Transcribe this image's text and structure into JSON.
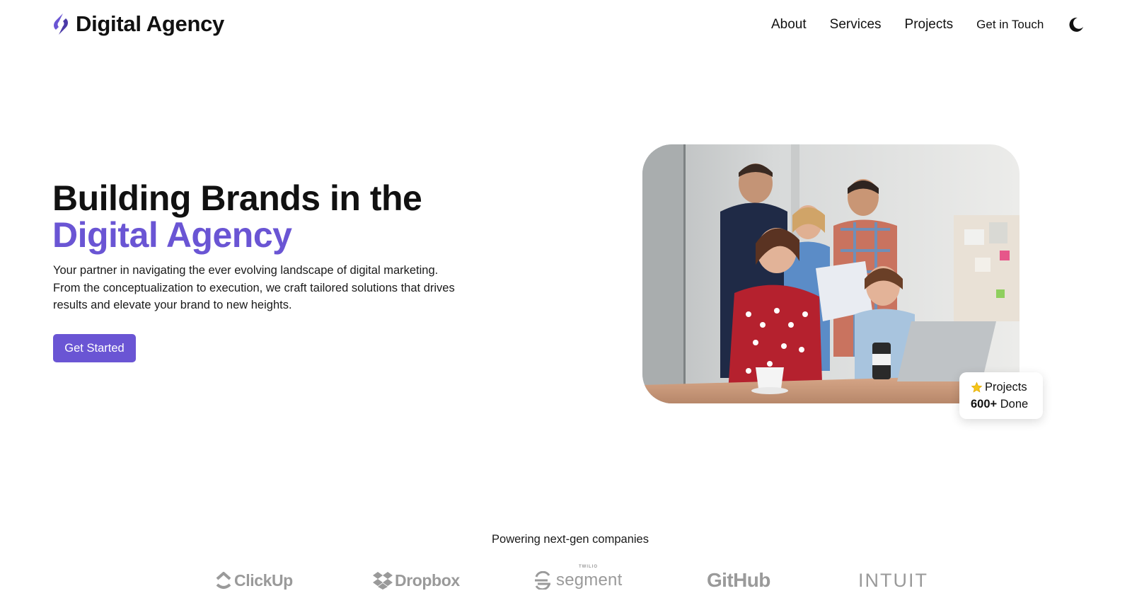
{
  "header": {
    "brand_name": "Digital Agency",
    "nav": {
      "about": "About",
      "services": "Services",
      "projects": "Projects",
      "get_in_touch": "Get in Touch"
    },
    "theme_toggle_icon": "moon-icon"
  },
  "hero": {
    "title_line1": "Building Brands in the",
    "title_line2": "Digital Agency",
    "description": "Your partner in navigating the ever evolving landscape of digital marketing. From the conceptualization to execution, we craft tailored solutions that drives results and elevate your brand to new heights.",
    "cta_label": "Get Started",
    "image_icon": "team-meeting-photo",
    "stat": {
      "icon": "star-icon",
      "label": "Projects",
      "value": "600+",
      "suffix": "Done"
    }
  },
  "partners": {
    "caption": "Powering next-gen companies",
    "logos": [
      {
        "name": "ClickUp",
        "icon": "clickup-logo"
      },
      {
        "name": "Dropbox",
        "icon": "dropbox-logo"
      },
      {
        "name": "segment",
        "small": "TWILIO",
        "icon": "segment-logo"
      },
      {
        "name": "GitHub",
        "icon": "github-logo"
      },
      {
        "name": "INTUIT",
        "icon": "intuit-logo"
      }
    ]
  },
  "colors": {
    "accent": "#6a55d4",
    "text": "#111111",
    "logo_gray": "#9a9a9a",
    "background": "#ffffff"
  }
}
